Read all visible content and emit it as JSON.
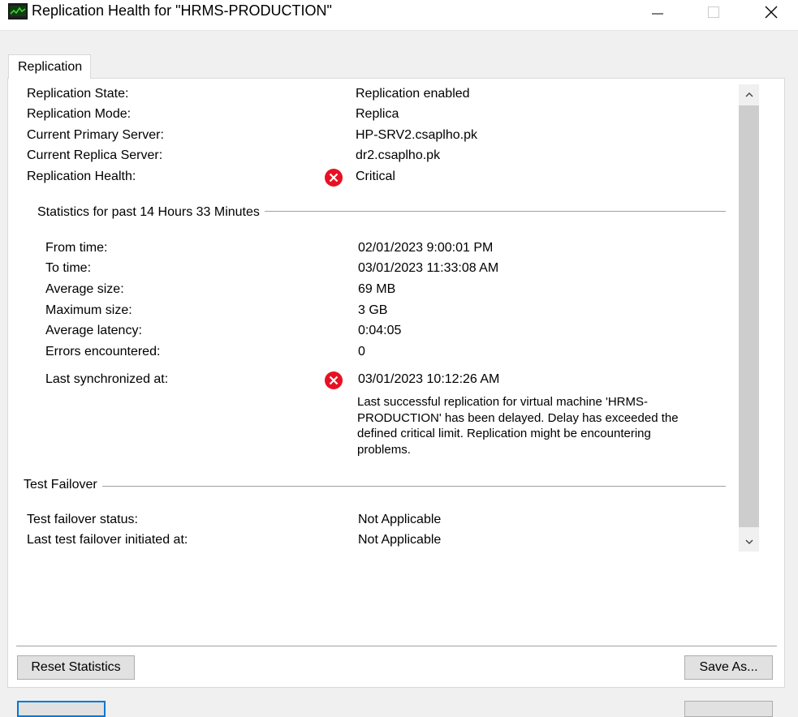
{
  "window": {
    "title": "Replication Health for \"HRMS-PRODUCTION\"",
    "icon": "hyperv-monitor-icon"
  },
  "tabs": [
    {
      "label": "Replication",
      "selected": true
    }
  ],
  "replication": {
    "state_label": "Replication State:",
    "state_value": "Replication enabled",
    "mode_label": "Replication Mode:",
    "mode_value": "Replica",
    "primary_label": "Current Primary Server:",
    "primary_value": "HP-SRV2.csaplho.pk",
    "replica_label": "Current Replica Server:",
    "replica_value": "dr2.csaplho.pk",
    "health_label": "Replication Health:",
    "health_value": "Critical",
    "health_icon": "error-icon"
  },
  "statistics": {
    "title": "Statistics for past 14 Hours 33 Minutes",
    "from_label": "From time:",
    "from_value": "02/01/2023 9:00:01 PM",
    "to_label": "To time:",
    "to_value": "03/01/2023 11:33:08 AM",
    "avg_size_label": "Average size:",
    "avg_size_value": "69 MB",
    "max_size_label": "Maximum size:",
    "max_size_value": "3 GB",
    "avg_latency_label": "Average latency:",
    "avg_latency_value": "0:04:05",
    "errors_label": "Errors encountered:",
    "errors_value": "0",
    "last_sync_label": "Last synchronized at:",
    "last_sync_value": "03/01/2023 10:12:26 AM",
    "last_sync_message": "Last successful replication for virtual machine 'HRMS-PRODUCTION' has been delayed. Delay has exceeded the defined critical limit. Replication might be encountering problems."
  },
  "test_failover": {
    "title": "Test Failover",
    "status_label": "Test failover status:",
    "status_value": "Not Applicable",
    "initiated_label": "Last test failover initiated at:",
    "initiated_value": "Not Applicable"
  },
  "buttons": {
    "reset": "Reset Statistics",
    "save_as": "Save As..."
  },
  "colors": {
    "error_red": "#e81123",
    "focus_blue": "#0078d7"
  }
}
